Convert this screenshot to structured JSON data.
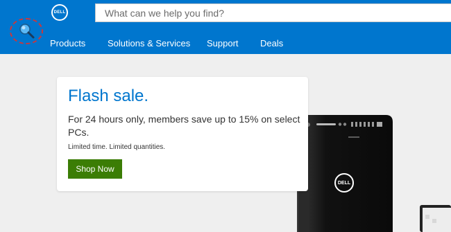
{
  "header": {
    "logo_text": "DELL",
    "search": {
      "placeholder": "What can we help you find?"
    },
    "nav": [
      {
        "label": "Products"
      },
      {
        "label": "Solutions & Services"
      },
      {
        "label": "Support"
      },
      {
        "label": "Deals"
      }
    ],
    "brand_color": "#0076ce"
  },
  "promo": {
    "title": "Flash sale.",
    "description": "For 24 hours only, members save up to 15% on select PCs.",
    "note": "Limited time. Limited quantities.",
    "button_label": "Shop Now",
    "button_color": "#3b7d05"
  },
  "product": {
    "tower_logo_text": "DELL"
  }
}
